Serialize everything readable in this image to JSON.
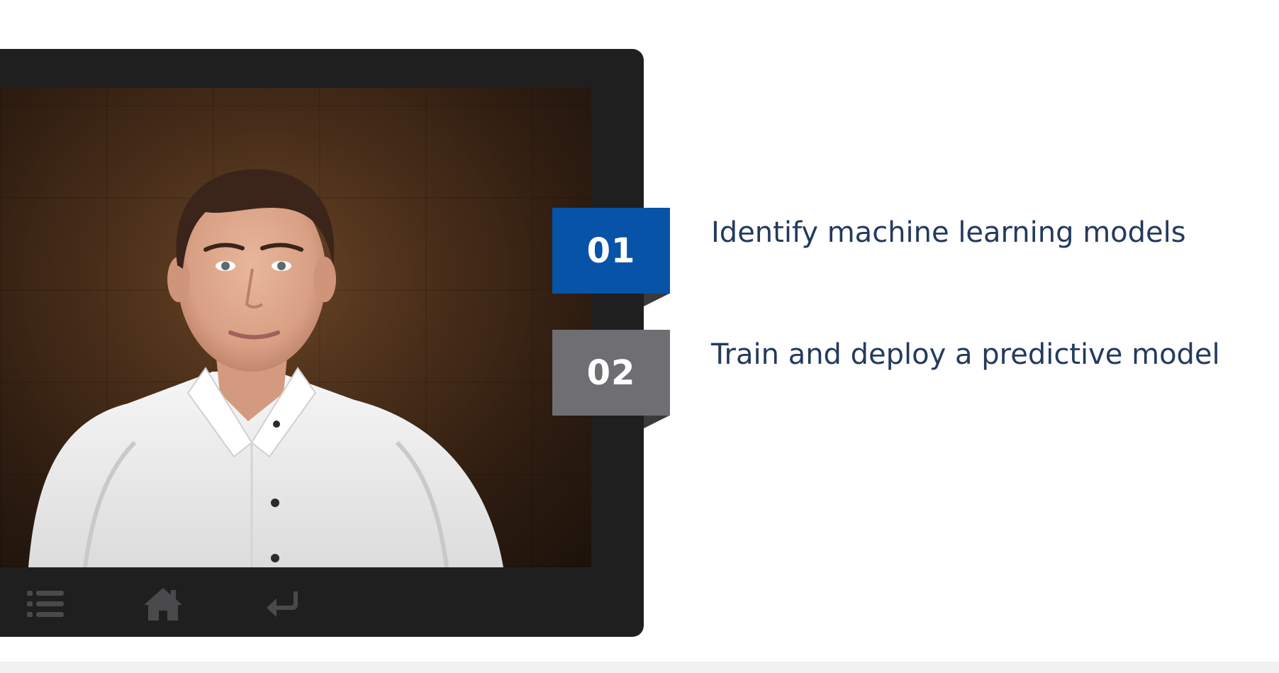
{
  "agenda": {
    "items": [
      {
        "number": "01",
        "label": "Identify machine learning models",
        "badge_color": "#0753a8",
        "state": "active"
      },
      {
        "number": "02",
        "label": "Train and deploy a predictive model",
        "badge_color": "#6f6f73",
        "state": "inactive"
      }
    ],
    "text_color": "#243a5e"
  },
  "player": {
    "frame_color": "#1f1f20",
    "toolbar": {
      "menu_icon": "list-icon",
      "home_icon": "home-icon",
      "back_icon": "return-arrow-icon",
      "icon_color": "#4a4a4c"
    }
  }
}
